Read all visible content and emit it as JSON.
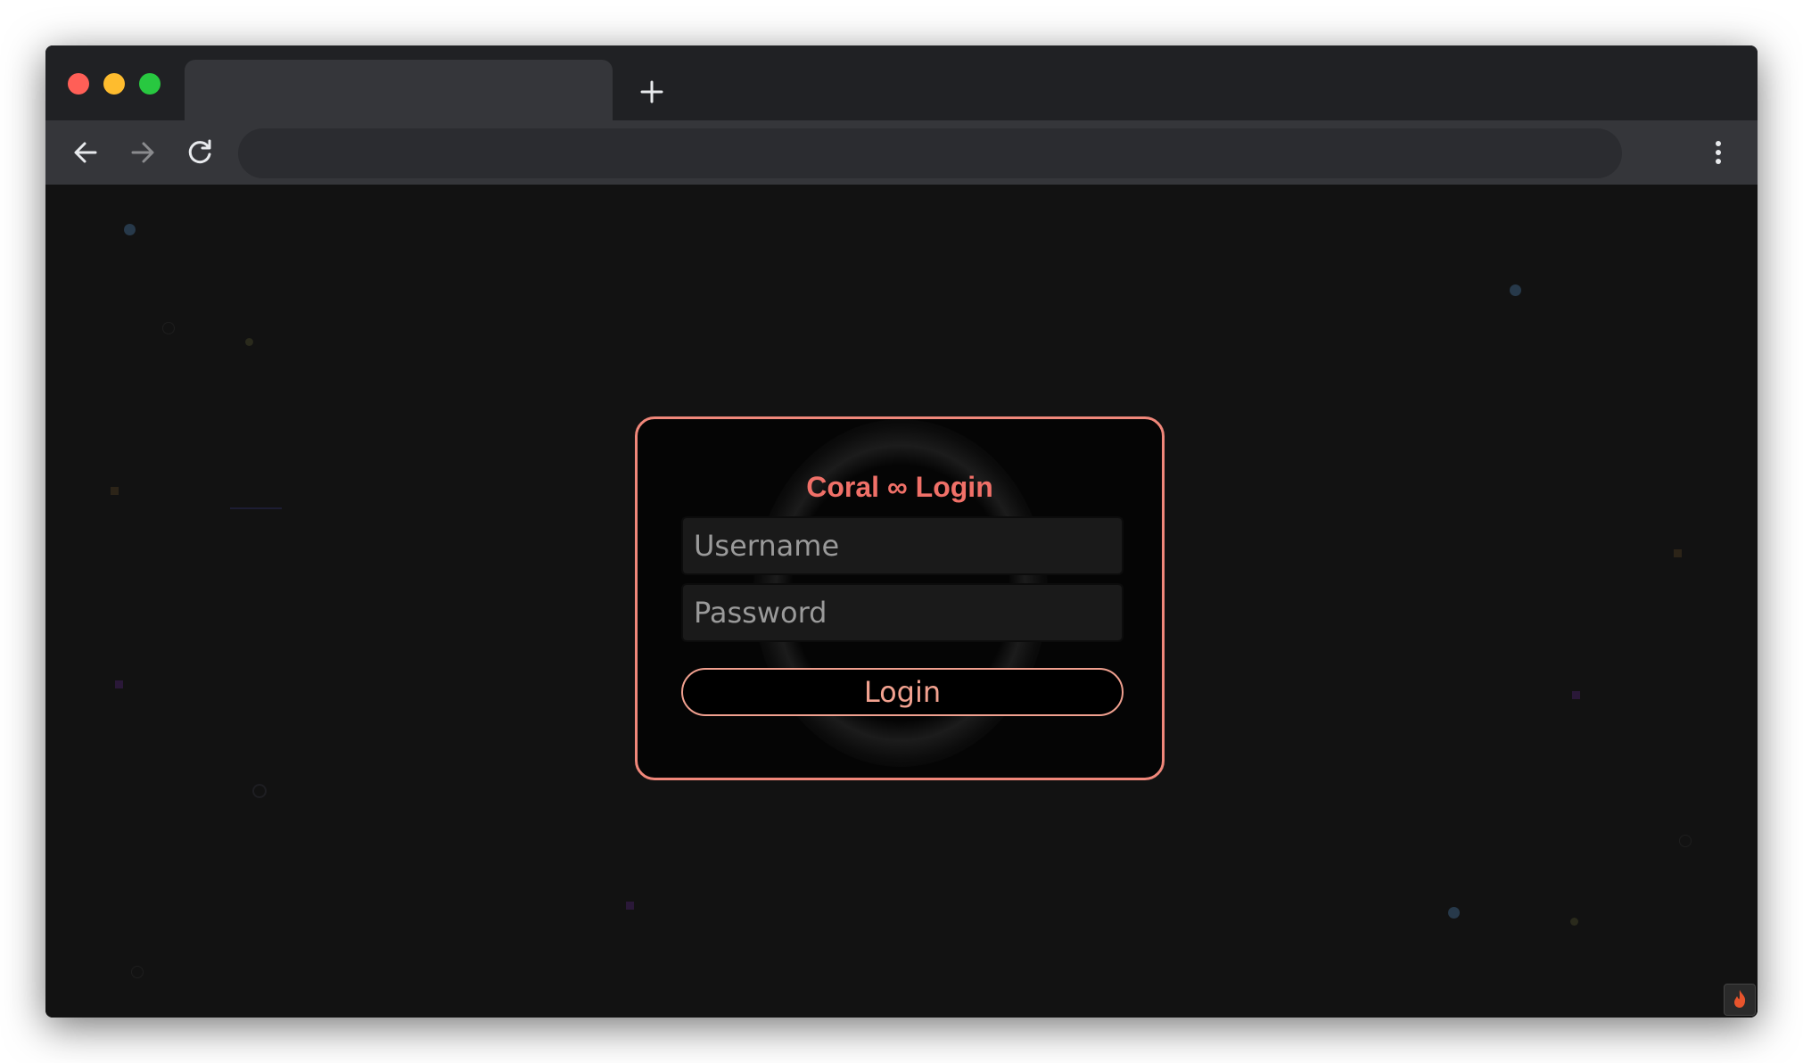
{
  "browser": {
    "tab_title": "",
    "address": "",
    "icons": {
      "new_tab": "plus-icon",
      "back": "arrow-left-icon",
      "forward": "arrow-right-icon",
      "reload": "reload-icon",
      "menu": "kebab-menu-icon"
    }
  },
  "login": {
    "title": "Coral ∞ Login",
    "username_placeholder": "Username",
    "password_placeholder": "Password",
    "submit_label": "Login"
  },
  "colors": {
    "accent": "#f07068",
    "border": "#f0877a",
    "page_bg": "#121212"
  },
  "corner_widget": {
    "icon": "flame-icon"
  }
}
